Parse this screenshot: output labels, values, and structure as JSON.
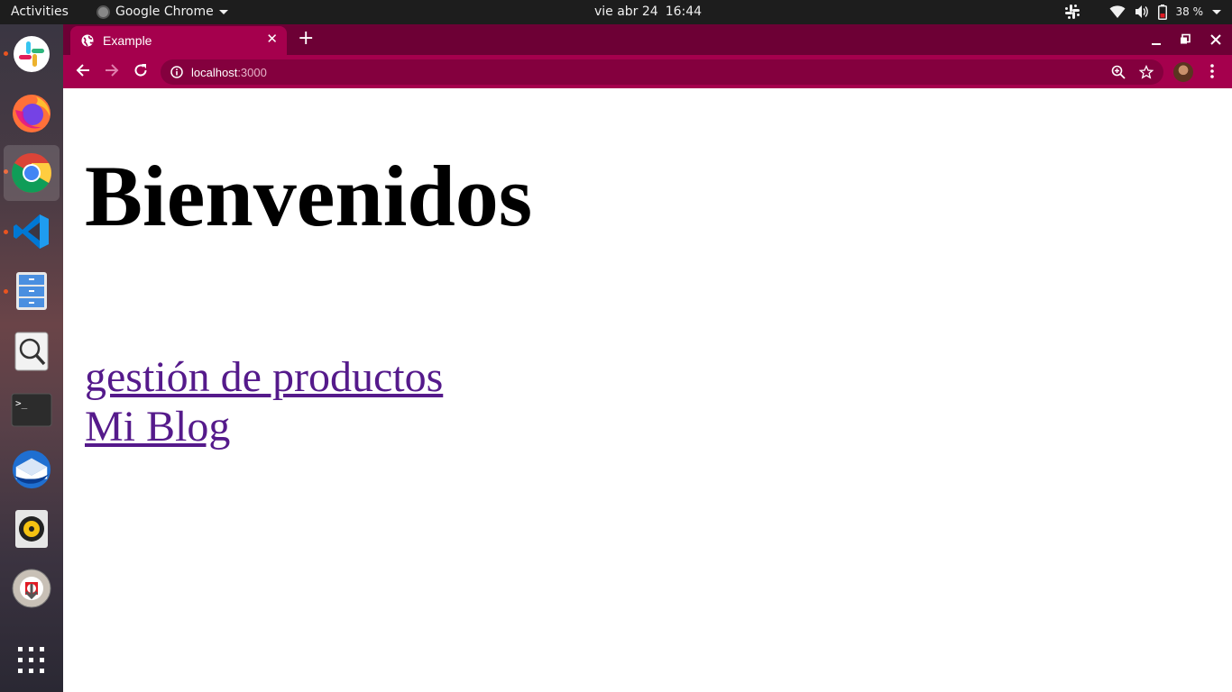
{
  "topbar": {
    "activities": "Activities",
    "app_name": "Google Chrome",
    "date": "vie abr 24",
    "time": "16:44",
    "battery": "38 %"
  },
  "dock": {
    "items": [
      "slack-icon",
      "firefox-icon",
      "chrome-icon",
      "vscode-icon",
      "file-cabinet-icon",
      "image-viewer-icon",
      "terminal-icon",
      "thunderbird-icon",
      "rhythmbox-icon",
      "help-lifebuoy-icon",
      "show-apps-icon"
    ]
  },
  "browser": {
    "tab_title": "Example",
    "url_host": "localhost",
    "url_port": ":3000",
    "theme_color": "#a5004d"
  },
  "page": {
    "heading": "Bienvenidos",
    "links": [
      "gestión de productos",
      "Mi Blog"
    ],
    "link_color": "#551a8b"
  }
}
